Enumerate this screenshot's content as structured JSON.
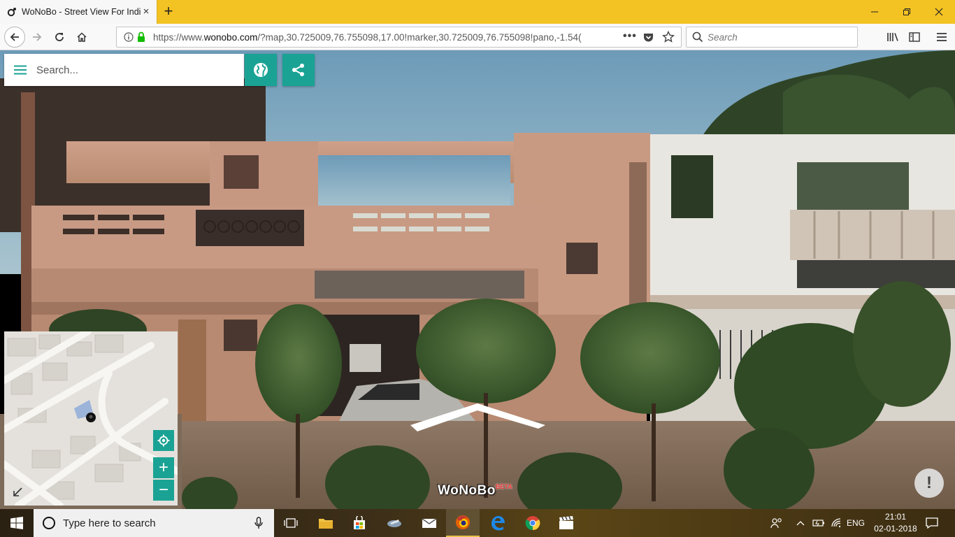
{
  "browser": {
    "tab_title": "WoNoBo - Street View For India",
    "url_prefix": "https://www.",
    "url_domain": "wonobo.com",
    "url_rest": "/?map,30.725009,76.755098,17.00!marker,30.725009,76.755098!pano,-1.54(",
    "search_placeholder": "Search"
  },
  "streetview": {
    "search_placeholder": "Search...",
    "logo_text": "WoNoBo",
    "logo_beta": "BETA",
    "report_label": "!"
  },
  "minimap": {
    "zoom_in_label": "+",
    "zoom_out_label": "−"
  },
  "taskbar": {
    "search_placeholder": "Type here to search",
    "language": "ENG",
    "time": "21:01",
    "date": "02-01-2018"
  },
  "colors": {
    "tab_bar": "#f3c223",
    "accent": "#1aa394"
  }
}
